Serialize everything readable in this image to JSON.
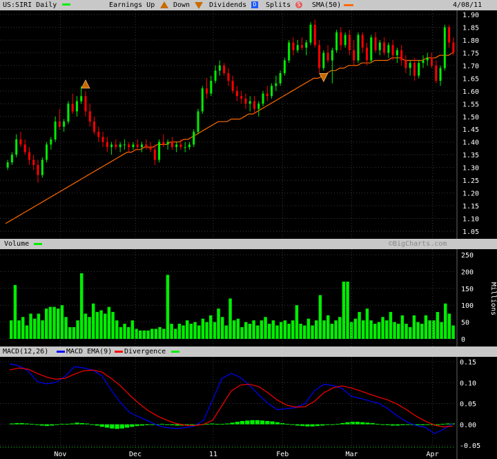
{
  "header": {
    "symbol": "US:SIRI Daily",
    "earnings_label": "Earnings Up",
    "down_label": "Down",
    "dividends_label": "Dividends",
    "splits_label": "Splits",
    "sma_label": "SMA(50)",
    "date": "4/08/11",
    "dividends_marker": "D",
    "splits_marker": "S"
  },
  "volume_header": {
    "label": "Volume",
    "brand": "©BigCharts.com"
  },
  "macd_header": {
    "macd_label": "MACD(12,26)",
    "ema_label": "MACD EMA(9)",
    "divergence_label": "Divergence"
  },
  "colors": {
    "background": "#000000",
    "up": "#00ee00",
    "down": "#ff0000",
    "sma": "#ff6a00",
    "volume": "#00ee00",
    "macd": "#0000ff",
    "ema": "#ff0000",
    "divergence": "#00ee00",
    "grid": "#3a3a3a",
    "axis_text": "#ffffff",
    "header_bg": "#c8c8c8"
  },
  "chart_data": [
    {
      "type": "candlestick",
      "title": "US:SIRI Daily",
      "ylim": [
        1.05,
        1.9
      ],
      "yticks": [
        "1.90",
        "1.85",
        "1.80",
        "1.75",
        "1.70",
        "1.65",
        "1.60",
        "1.55",
        "1.50",
        "1.45",
        "1.40",
        "1.35",
        "1.30",
        "1.25",
        "1.20",
        "1.15",
        "1.10",
        "1.05"
      ],
      "grid": true,
      "candles": [
        [
          1.3,
          1.33,
          1.29,
          1.32
        ],
        [
          1.32,
          1.36,
          1.31,
          1.35
        ],
        [
          1.35,
          1.43,
          1.34,
          1.41
        ],
        [
          1.41,
          1.44,
          1.38,
          1.39
        ],
        [
          1.39,
          1.41,
          1.35,
          1.36
        ],
        [
          1.36,
          1.38,
          1.31,
          1.33
        ],
        [
          1.33,
          1.35,
          1.29,
          1.31
        ],
        [
          1.31,
          1.33,
          1.24,
          1.27
        ],
        [
          1.27,
          1.34,
          1.26,
          1.33
        ],
        [
          1.33,
          1.4,
          1.32,
          1.39
        ],
        [
          1.39,
          1.42,
          1.37,
          1.41
        ],
        [
          1.41,
          1.5,
          1.4,
          1.48
        ],
        [
          1.48,
          1.53,
          1.45,
          1.46
        ],
        [
          1.46,
          1.49,
          1.44,
          1.48
        ],
        [
          1.48,
          1.56,
          1.47,
          1.55
        ],
        [
          1.55,
          1.59,
          1.51,
          1.52
        ],
        [
          1.52,
          1.58,
          1.5,
          1.56
        ],
        [
          1.56,
          1.62,
          1.55,
          1.58
        ],
        [
          1.58,
          1.6,
          1.5,
          1.52
        ],
        [
          1.52,
          1.55,
          1.46,
          1.48
        ],
        [
          1.48,
          1.5,
          1.43,
          1.44
        ],
        [
          1.44,
          1.46,
          1.4,
          1.42
        ],
        [
          1.42,
          1.44,
          1.38,
          1.4
        ],
        [
          1.4,
          1.42,
          1.36,
          1.38
        ],
        [
          1.38,
          1.4,
          1.35,
          1.39
        ],
        [
          1.39,
          1.41,
          1.37,
          1.38
        ],
        [
          1.38,
          1.4,
          1.36,
          1.39
        ],
        [
          1.39,
          1.41,
          1.37,
          1.39
        ],
        [
          1.39,
          1.4,
          1.36,
          1.38
        ],
        [
          1.38,
          1.4,
          1.37,
          1.39
        ],
        [
          1.39,
          1.41,
          1.37,
          1.38
        ],
        [
          1.38,
          1.4,
          1.36,
          1.39
        ],
        [
          1.39,
          1.41,
          1.37,
          1.38
        ],
        [
          1.38,
          1.4,
          1.36,
          1.37
        ],
        [
          1.37,
          1.39,
          1.31,
          1.33
        ],
        [
          1.33,
          1.41,
          1.32,
          1.4
        ],
        [
          1.4,
          1.43,
          1.38,
          1.39
        ],
        [
          1.39,
          1.41,
          1.37,
          1.4
        ],
        [
          1.4,
          1.42,
          1.37,
          1.38
        ],
        [
          1.38,
          1.4,
          1.36,
          1.39
        ],
        [
          1.39,
          1.41,
          1.37,
          1.38
        ],
        [
          1.38,
          1.4,
          1.36,
          1.38
        ],
        [
          1.38,
          1.4,
          1.37,
          1.39
        ],
        [
          1.39,
          1.45,
          1.38,
          1.44
        ],
        [
          1.44,
          1.53,
          1.43,
          1.52
        ],
        [
          1.52,
          1.62,
          1.51,
          1.61
        ],
        [
          1.61,
          1.65,
          1.57,
          1.59
        ],
        [
          1.59,
          1.66,
          1.58,
          1.64
        ],
        [
          1.64,
          1.7,
          1.63,
          1.68
        ],
        [
          1.68,
          1.72,
          1.66,
          1.7
        ],
        [
          1.7,
          1.71,
          1.66,
          1.67
        ],
        [
          1.67,
          1.69,
          1.62,
          1.64
        ],
        [
          1.64,
          1.66,
          1.59,
          1.6
        ],
        [
          1.6,
          1.62,
          1.56,
          1.58
        ],
        [
          1.58,
          1.6,
          1.55,
          1.57
        ],
        [
          1.57,
          1.59,
          1.53,
          1.55
        ],
        [
          1.55,
          1.58,
          1.52,
          1.56
        ],
        [
          1.56,
          1.58,
          1.51,
          1.53
        ],
        [
          1.53,
          1.56,
          1.5,
          1.55
        ],
        [
          1.55,
          1.6,
          1.54,
          1.59
        ],
        [
          1.59,
          1.62,
          1.56,
          1.58
        ],
        [
          1.58,
          1.63,
          1.57,
          1.62
        ],
        [
          1.62,
          1.66,
          1.6,
          1.63
        ],
        [
          1.63,
          1.68,
          1.62,
          1.67
        ],
        [
          1.67,
          1.73,
          1.66,
          1.72
        ],
        [
          1.72,
          1.8,
          1.71,
          1.79
        ],
        [
          1.79,
          1.81,
          1.74,
          1.76
        ],
        [
          1.76,
          1.8,
          1.75,
          1.78
        ],
        [
          1.78,
          1.81,
          1.76,
          1.77
        ],
        [
          1.77,
          1.8,
          1.74,
          1.79
        ],
        [
          1.79,
          1.87,
          1.78,
          1.86
        ],
        [
          1.86,
          1.88,
          1.77,
          1.78
        ],
        [
          1.78,
          1.8,
          1.67,
          1.69
        ],
        [
          1.69,
          1.76,
          1.68,
          1.75
        ],
        [
          1.75,
          1.78,
          1.71,
          1.72
        ],
        [
          1.72,
          1.77,
          1.63,
          1.76
        ],
        [
          1.76,
          1.84,
          1.75,
          1.83
        ],
        [
          1.83,
          1.85,
          1.76,
          1.78
        ],
        [
          1.78,
          1.83,
          1.77,
          1.82
        ],
        [
          1.82,
          1.84,
          1.74,
          1.76
        ],
        [
          1.76,
          1.8,
          1.7,
          1.72
        ],
        [
          1.72,
          1.83,
          1.71,
          1.82
        ],
        [
          1.82,
          1.83,
          1.75,
          1.77
        ],
        [
          1.77,
          1.79,
          1.7,
          1.72
        ],
        [
          1.72,
          1.82,
          1.71,
          1.81
        ],
        [
          1.81,
          1.83,
          1.75,
          1.76
        ],
        [
          1.76,
          1.8,
          1.74,
          1.79
        ],
        [
          1.79,
          1.81,
          1.74,
          1.75
        ],
        [
          1.75,
          1.79,
          1.73,
          1.78
        ],
        [
          1.78,
          1.8,
          1.72,
          1.74
        ],
        [
          1.74,
          1.77,
          1.71,
          1.76
        ],
        [
          1.76,
          1.78,
          1.7,
          1.72
        ],
        [
          1.72,
          1.74,
          1.67,
          1.69
        ],
        [
          1.69,
          1.72,
          1.66,
          1.71
        ],
        [
          1.71,
          1.73,
          1.64,
          1.66
        ],
        [
          1.66,
          1.72,
          1.65,
          1.71
        ],
        [
          1.71,
          1.74,
          1.69,
          1.72
        ],
        [
          1.72,
          1.75,
          1.7,
          1.73
        ],
        [
          1.73,
          1.75,
          1.69,
          1.7
        ],
        [
          1.7,
          1.72,
          1.63,
          1.64
        ],
        [
          1.64,
          1.7,
          1.62,
          1.69
        ],
        [
          1.69,
          1.86,
          1.68,
          1.85
        ],
        [
          1.85,
          1.86,
          1.77,
          1.79
        ],
        [
          1.79,
          1.81,
          1.74,
          1.75
        ]
      ],
      "sma50": [
        1.08,
        1.09,
        1.1,
        1.11,
        1.12,
        1.13,
        1.14,
        1.15,
        1.16,
        1.17,
        1.18,
        1.19,
        1.2,
        1.21,
        1.22,
        1.23,
        1.24,
        1.25,
        1.26,
        1.27,
        1.28,
        1.29,
        1.3,
        1.31,
        1.32,
        1.33,
        1.34,
        1.35,
        1.36,
        1.36,
        1.37,
        1.37,
        1.38,
        1.38,
        1.38,
        1.39,
        1.39,
        1.39,
        1.4,
        1.4,
        1.4,
        1.41,
        1.41,
        1.42,
        1.43,
        1.44,
        1.45,
        1.46,
        1.47,
        1.48,
        1.48,
        1.48,
        1.49,
        1.49,
        1.49,
        1.5,
        1.51,
        1.51,
        1.52,
        1.53,
        1.54,
        1.55,
        1.56,
        1.57,
        1.58,
        1.59,
        1.6,
        1.61,
        1.62,
        1.63,
        1.64,
        1.65,
        1.65,
        1.66,
        1.67,
        1.68,
        1.68,
        1.69,
        1.69,
        1.7,
        1.7,
        1.7,
        1.71,
        1.71,
        1.71,
        1.72,
        1.72,
        1.72,
        1.72,
        1.73,
        1.73,
        1.73,
        1.72,
        1.72,
        1.72,
        1.72,
        1.72,
        1.73,
        1.73,
        1.73,
        1.74,
        1.74,
        1.74,
        1.75
      ],
      "earnings_up_index": 18,
      "earnings_down_index": 73
    },
    {
      "type": "bar",
      "title": "Volume",
      "ylabel": "Millions",
      "ylim": [
        0,
        250
      ],
      "yticks": [
        "250",
        "200",
        "150",
        "100",
        "50",
        "0"
      ],
      "values": [
        55,
        160,
        55,
        65,
        40,
        75,
        60,
        75,
        55,
        90,
        95,
        95,
        90,
        100,
        65,
        35,
        35,
        55,
        195,
        75,
        65,
        105,
        80,
        85,
        75,
        95,
        80,
        55,
        35,
        45,
        35,
        55,
        30,
        25,
        25,
        25,
        30,
        30,
        35,
        30,
        190,
        45,
        30,
        45,
        40,
        55,
        45,
        50,
        40,
        60,
        50,
        70,
        50,
        90,
        65,
        40,
        120,
        55,
        60,
        35,
        50,
        45,
        55,
        40,
        55,
        65,
        45,
        55,
        40,
        50,
        55,
        45,
        55,
        100,
        45,
        40,
        60,
        40,
        55,
        130,
        55,
        70,
        45,
        55,
        65,
        170,
        170,
        50,
        60,
        80,
        55,
        90,
        55,
        45,
        50,
        65,
        55,
        80,
        50,
        45,
        70,
        45,
        35,
        70,
        50,
        45,
        70,
        55,
        55,
        80,
        50,
        105,
        75,
        40
      ]
    },
    {
      "type": "line",
      "title": "MACD(12,26)",
      "ylim": [
        -0.05,
        0.15
      ],
      "yticks": [
        "0.15",
        "0.10",
        "0.05",
        "0.00",
        "-0.05"
      ],
      "x_ticks": [
        {
          "label": "Nov",
          "index": 19
        },
        {
          "label": "Dec",
          "index": 45
        },
        {
          "label": "11",
          "index": 72
        },
        {
          "label": "Feb",
          "index": 96
        },
        {
          "label": "Mar",
          "index": 120
        },
        {
          "label": "Apr",
          "index": 148
        }
      ],
      "series": [
        {
          "name": "MACD(12,26)",
          "values": [
            0.145,
            0.14,
            0.128,
            0.102,
            0.097,
            0.1,
            0.115,
            0.138,
            0.135,
            0.13,
            0.116,
            0.082,
            0.052,
            0.028,
            0.018,
            0.008,
            -0.002,
            -0.008,
            -0.01,
            -0.008,
            -0.004,
            0.01,
            0.06,
            0.11,
            0.122,
            0.112,
            0.093,
            0.07,
            0.05,
            0.035,
            0.038,
            0.04,
            0.05,
            0.08,
            0.096,
            0.093,
            0.086,
            0.067,
            0.062,
            0.056,
            0.05,
            0.037,
            0.02,
            0.006,
            -0.003,
            -0.007,
            -0.022,
            -0.012,
            0.002
          ]
        },
        {
          "name": "MACD EMA(9)",
          "values": [
            0.13,
            0.135,
            0.132,
            0.122,
            0.113,
            0.108,
            0.11,
            0.12,
            0.128,
            0.13,
            0.125,
            0.11,
            0.092,
            0.07,
            0.05,
            0.033,
            0.02,
            0.01,
            0.002,
            -0.002,
            -0.003,
            0.0,
            0.01,
            0.045,
            0.08,
            0.094,
            0.096,
            0.09,
            0.075,
            0.058,
            0.046,
            0.041,
            0.042,
            0.055,
            0.075,
            0.087,
            0.092,
            0.087,
            0.08,
            0.072,
            0.065,
            0.058,
            0.048,
            0.035,
            0.02,
            0.008,
            -0.002,
            -0.006,
            -0.004
          ]
        }
      ],
      "divergence": [
        2,
        3,
        3,
        2,
        1,
        -1,
        -3,
        -4,
        -3,
        -1,
        1,
        1,
        2,
        4,
        3,
        2,
        0,
        -3,
        -6,
        -8,
        -10,
        -11,
        -10,
        -8,
        -6,
        -4,
        -3,
        -2,
        -1,
        0,
        1,
        0,
        -2,
        -3,
        -3,
        -2,
        -1,
        0,
        0,
        1,
        2,
        1,
        1,
        2,
        4,
        6,
        8,
        9,
        10,
        10,
        9,
        8,
        7,
        5,
        3,
        1,
        -1,
        -3,
        -4,
        -5,
        -5,
        -4,
        -3,
        -1,
        0,
        1,
        3,
        5,
        6,
        6,
        5,
        4,
        3,
        1,
        -1,
        -2,
        -3,
        -3,
        -2,
        -1,
        -1,
        -2,
        -2,
        -1,
        -1,
        0,
        1,
        2,
        2
      ]
    }
  ]
}
